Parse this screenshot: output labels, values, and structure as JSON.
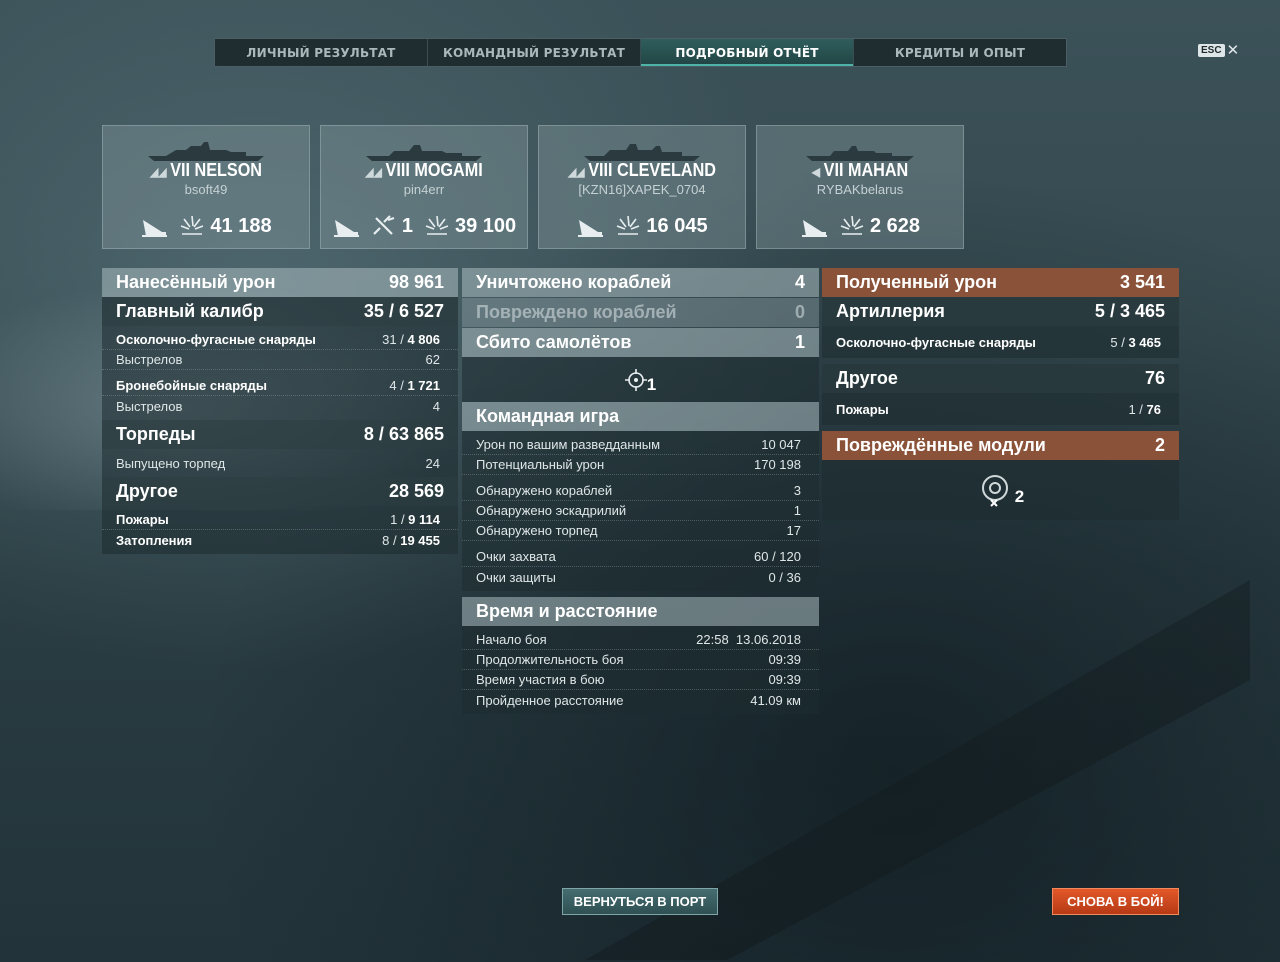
{
  "tabs": [
    {
      "label": "ЛИЧНЫЙ РЕЗУЛЬТАТ"
    },
    {
      "label": "КОМАНДНЫЙ РЕЗУЛЬТАТ"
    },
    {
      "label": "ПОДРОБНЫЙ ОТЧЁТ"
    },
    {
      "label": "КРЕДИТЫ И ОПЫТ"
    }
  ],
  "esc": {
    "key": "ESC",
    "close": "✕"
  },
  "ships": [
    {
      "class": "◢◢",
      "name": "VII NELSON",
      "player": "bsoft49",
      "planes": "",
      "damage": "41 188"
    },
    {
      "class": "◢◢",
      "name": "VIII MOGAMI",
      "player": "pin4err",
      "planes": "1",
      "damage": "39 100"
    },
    {
      "class": "◢◢",
      "name": "VIII CLEVELAND",
      "player": "[KZN16]XAPEK_0704",
      "planes": "",
      "damage": "16 045"
    },
    {
      "class": "◀",
      "name": "VII MAHAN",
      "player": "RYBAKbelarus",
      "planes": "",
      "damage": "2 628"
    }
  ],
  "left": {
    "damage": {
      "label": "Нанесённый урон",
      "value": "98 961"
    },
    "main": {
      "label": "Главный калибр",
      "hits": "35",
      "value": "6 527"
    },
    "he": {
      "label": "Осколочно-фугасные снаряды",
      "hits": "31",
      "value": "4 806"
    },
    "he_shots": {
      "label": "Выстрелов",
      "value": "62"
    },
    "ap": {
      "label": "Бронебойные снаряды",
      "hits": "4",
      "value": "1 721"
    },
    "ap_shots": {
      "label": "Выстрелов",
      "value": "4"
    },
    "torp": {
      "label": "Торпеды",
      "hits": "8",
      "value": "63 865"
    },
    "torp_launched": {
      "label": "Выпущено торпед",
      "value": "24"
    },
    "other": {
      "label": "Другое",
      "value": "28 569"
    },
    "fires": {
      "label": "Пожары",
      "hits": "1",
      "value": "9 114"
    },
    "floods": {
      "label": "Затопления",
      "hits": "8",
      "value": "19 455"
    }
  },
  "mid": {
    "destroyed": {
      "label": "Уничтожено кораблей",
      "value": "4"
    },
    "damaged": {
      "label": "Повреждено кораблей",
      "value": "0"
    },
    "planes": {
      "label": "Сбито самолётов",
      "value": "1"
    },
    "planes_icon_count": "1",
    "team": {
      "label": "Командная игра"
    },
    "spot_dmg": {
      "label": "Урон по вашим разведданным",
      "value": "10 047"
    },
    "pot_dmg": {
      "label": "Потенциальный урон",
      "value": "170 198"
    },
    "spot_ships": {
      "label": "Обнаружено кораблей",
      "value": "3"
    },
    "spot_sq": {
      "label": "Обнаружено эскадрилий",
      "value": "1"
    },
    "spot_torp": {
      "label": "Обнаружено торпед",
      "value": "17"
    },
    "capture": {
      "label": "Очки захвата",
      "value": "60 / 120"
    },
    "defense": {
      "label": "Очки защиты",
      "value": "0 / 36"
    },
    "time": {
      "label": "Время и расстояние"
    },
    "start": {
      "label": "Начало боя",
      "value": "22:58  13.06.2018"
    },
    "duration": {
      "label": "Продолжительность боя",
      "value": "09:39"
    },
    "participation": {
      "label": "Время участия в бою",
      "value": "09:39"
    },
    "distance": {
      "label": "Пройденное расстояние",
      "value": "41.09 км"
    }
  },
  "right": {
    "received": {
      "label": "Полученный урон",
      "value": "3 541"
    },
    "art": {
      "label": "Артиллерия",
      "hits": "5",
      "value": "3 465"
    },
    "he": {
      "label": "Осколочно-фугасные снаряды",
      "hits": "5",
      "value": "3 465"
    },
    "other": {
      "label": "Другое",
      "value": "76"
    },
    "fires": {
      "label": "Пожары",
      "hits": "1",
      "value": "76"
    },
    "modules": {
      "label": "Повреждённые модули",
      "value": "2"
    },
    "modules_icon_count": "2"
  },
  "buttons": {
    "port": "ВЕРНУТЬСЯ В ПОРТ",
    "battle": "СНОВА В БОЙ!"
  },
  "colors": {
    "accent": "#4fb3a8",
    "received": "#8a5238",
    "battle_button": "#d64a1f"
  }
}
